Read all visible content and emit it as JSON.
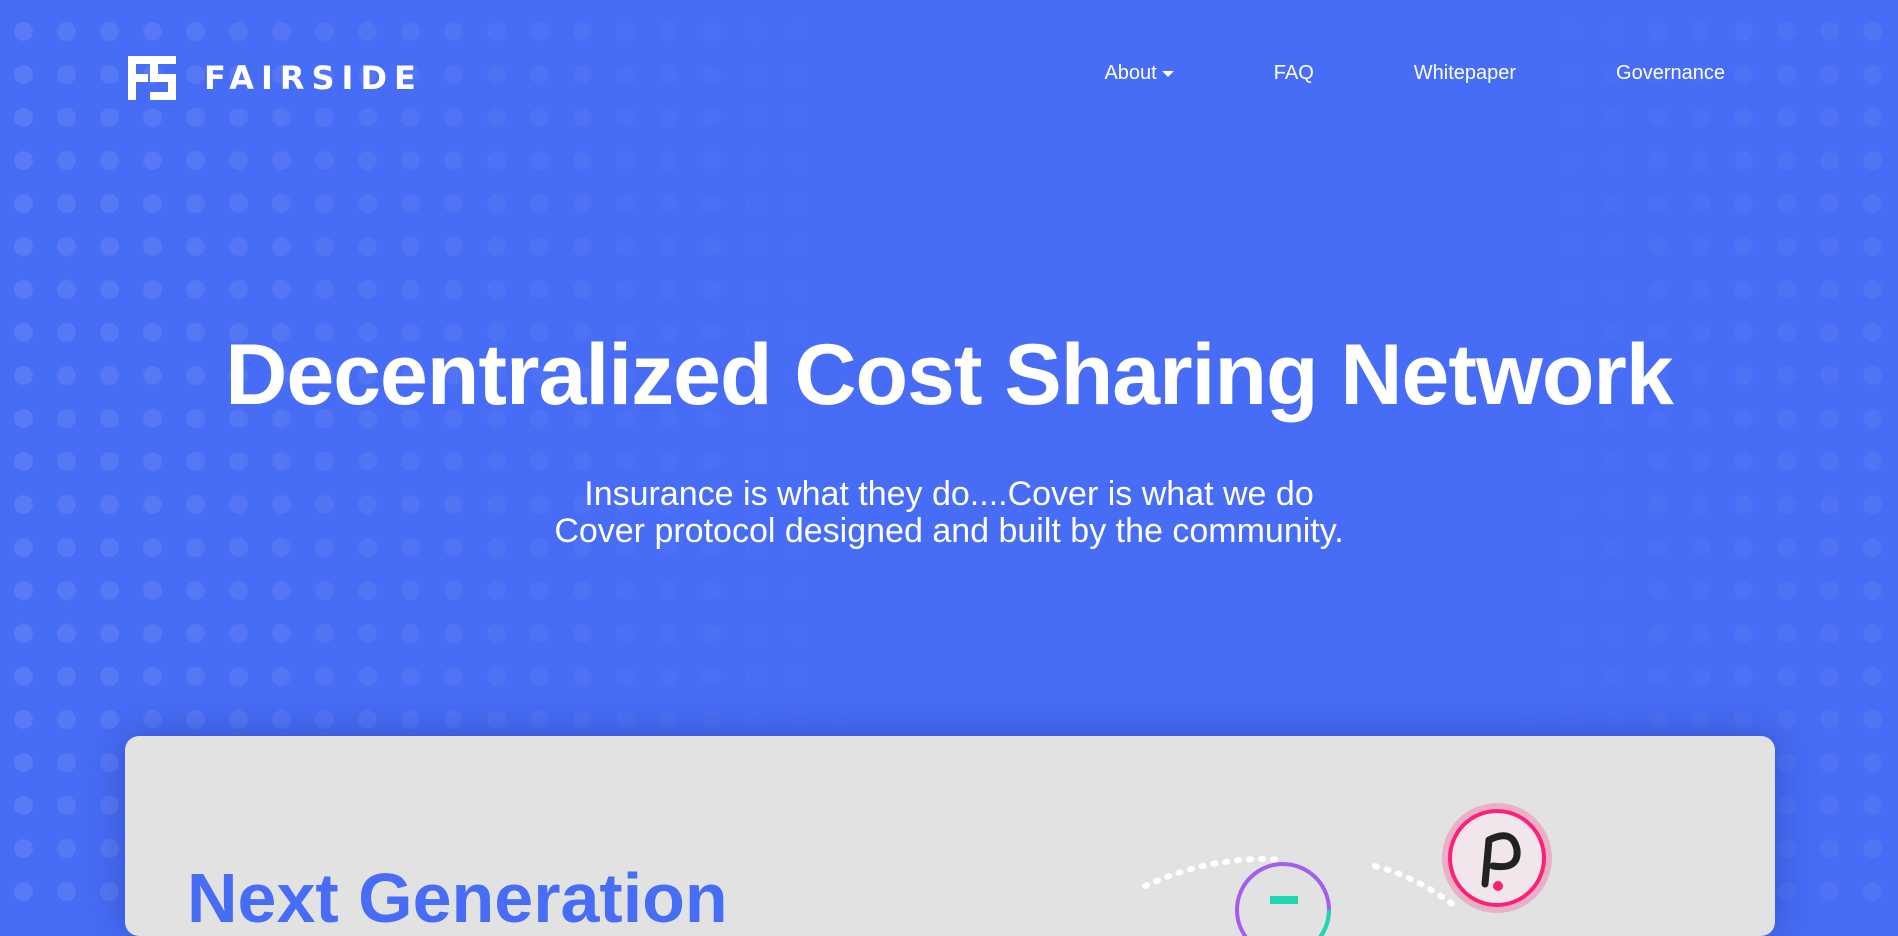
{
  "brand": {
    "name": "FAIRSIDE",
    "logo_icon": "fs-logo-icon"
  },
  "nav": {
    "items": [
      {
        "label": "About",
        "has_dropdown": true,
        "icon": "caret-down-icon"
      },
      {
        "label": "FAQ"
      },
      {
        "label": "Whitepaper"
      },
      {
        "label": "Governance"
      }
    ]
  },
  "hero": {
    "title": "Decentralized Cost Sharing Network",
    "subtitle_line1": "Insurance is what they do....Cover is what we do",
    "subtitle_line2": "Cover protocol designed and built by the community."
  },
  "card": {
    "title": "Next Generation",
    "icons": [
      "polkadot-icon",
      "token-icon"
    ]
  },
  "colors": {
    "background": "#476cf5",
    "text": "#ffffff",
    "card_bg": "#e2e2e2",
    "accent_pink": "#ff1e7a",
    "accent_teal": "#1ed7b0"
  }
}
